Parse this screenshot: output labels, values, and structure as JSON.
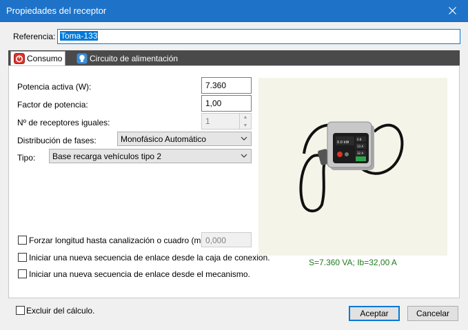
{
  "window": {
    "title": "Propiedades del receptor"
  },
  "referencia": {
    "label": "Referencia:",
    "value": "Toma-133"
  },
  "tabs": [
    {
      "label": "Consumo"
    },
    {
      "label": "Circuito de alimentación"
    }
  ],
  "consumo": {
    "potencia_label": "Potencia activa (W):",
    "potencia_value": "7.360",
    "factor_label": "Factor de potencia:",
    "factor_value": "1,00",
    "receptores_label": "Nº de receptores iguales:",
    "receptores_value": "1",
    "distribucion_label": "Distribución de fases:",
    "distribucion_value": "Monofásico Automático",
    "tipo_label": "Tipo:",
    "tipo_value": "Base recarga vehículos tipo 2",
    "forzar_label": "Forzar longitud hasta canalización o cuadro (m):",
    "forzar_value": "0,000",
    "secuencia_caja_label": "Iniciar una nueva secuencia de enlace desde la caja de conexión.",
    "secuencia_mecanismo_label": "Iniciar una nueva secuencia de enlace desde el mecanismo.",
    "preview_caption": "S=7.360 VA; Ib=32,00 A",
    "device_display": {
      "reading": "0.0 kW",
      "side1": "0.8",
      "side2": "13 A",
      "side3": "32 A"
    }
  },
  "footer": {
    "excluir_label": "Excluir del cálculo.",
    "aceptar_label": "Aceptar",
    "cancelar_label": "Cancelar"
  },
  "colors": {
    "titlebar": "#1e73c8",
    "caption": "#1e7a1e",
    "tabstrip": "#4a4a4a"
  },
  "icons": [
    "close-icon",
    "power-icon",
    "lightbulb-icon",
    "chevron-down-icon",
    "ev-charger-image"
  ]
}
